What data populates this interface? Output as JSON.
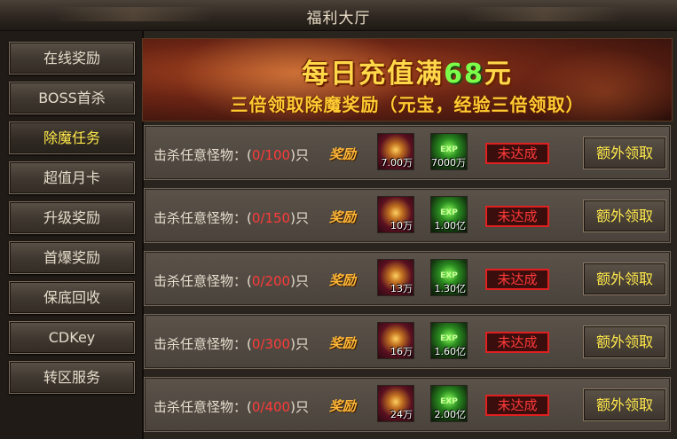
{
  "window": {
    "title": "福利大厅"
  },
  "sidebar": {
    "items": [
      {
        "label": "在线奖励"
      },
      {
        "label": "BOSS首杀"
      },
      {
        "label": "除魔任务",
        "active": true
      },
      {
        "label": "超值月卡"
      },
      {
        "label": "升级奖励"
      },
      {
        "label": "首爆奖励"
      },
      {
        "label": "保底回收"
      },
      {
        "label": "CDKey"
      },
      {
        "label": "转区服务"
      }
    ]
  },
  "banner": {
    "line1_prefix": "每日充值满",
    "line1_amount": "68",
    "line1_suffix": "元",
    "line2": "三倍领取除魔奖励（元宝，经验三倍领取）"
  },
  "tasks": {
    "reward_label": "奖励",
    "rows": [
      {
        "task": "击杀任意怪物：(",
        "progress": "0/100",
        "unit": ")只",
        "gold": "7.00万",
        "exp": "7000万",
        "status": "未达成",
        "button": "额外领取"
      },
      {
        "task": "击杀任意怪物：(",
        "progress": "0/150",
        "unit": ")只",
        "gold": "10万",
        "exp": "1.00亿",
        "status": "未达成",
        "button": "额外领取"
      },
      {
        "task": "击杀任意怪物：(",
        "progress": "0/200",
        "unit": ")只",
        "gold": "13万",
        "exp": "1.30亿",
        "status": "未达成",
        "button": "额外领取"
      },
      {
        "task": "击杀任意怪物：(",
        "progress": "0/300",
        "unit": ")只",
        "gold": "16万",
        "exp": "1.60亿",
        "status": "未达成",
        "button": "额外领取"
      },
      {
        "task": "击杀任意怪物：(",
        "progress": "0/400",
        "unit": ")只",
        "gold": "24万",
        "exp": "2.00亿",
        "status": "未达成",
        "button": "额外领取"
      }
    ]
  },
  "colors": {
    "accent_yellow": "#ffe94a",
    "status_red": "#ff3a3a"
  }
}
